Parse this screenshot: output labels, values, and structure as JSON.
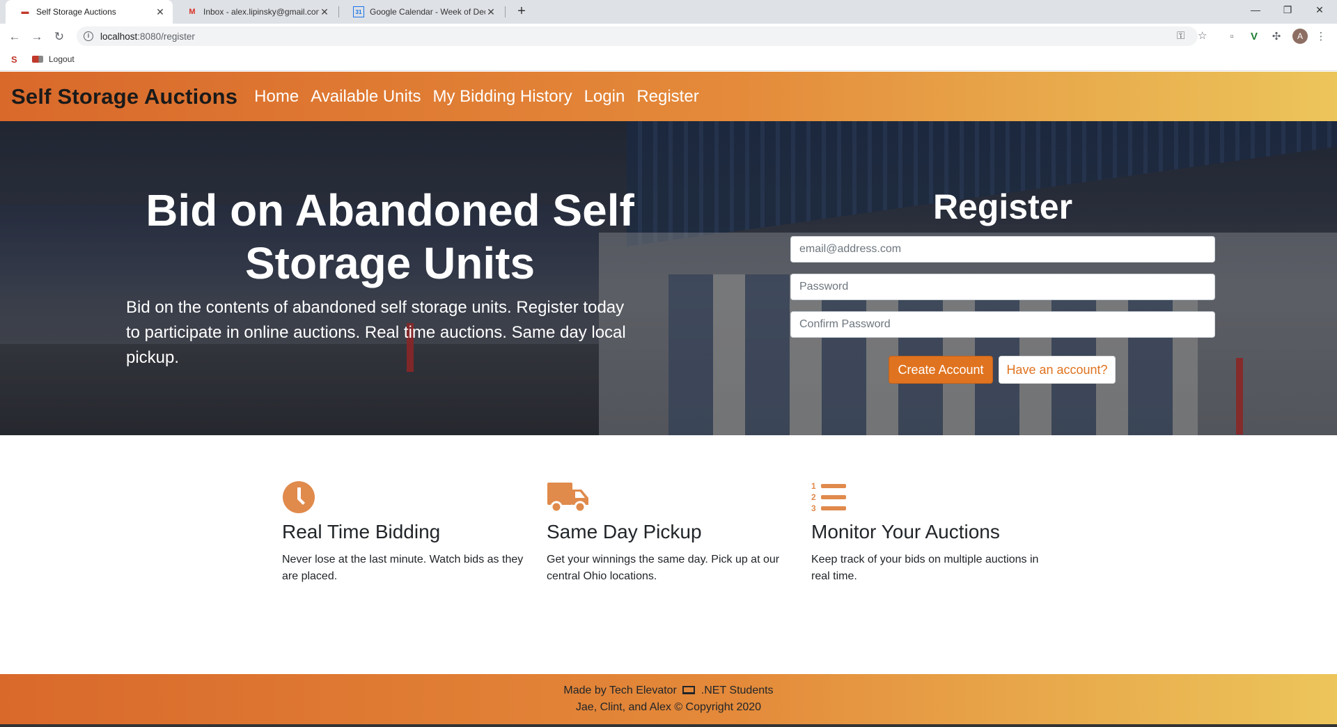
{
  "browser": {
    "tabs": [
      {
        "title": "Self Storage Auctions",
        "icon": "truck-favicon"
      },
      {
        "title": "Inbox - alex.lipinsky@gmail.com",
        "icon": "gmail-favicon"
      },
      {
        "title": "Google Calendar - Week of Dece",
        "icon": "calendar-favicon"
      }
    ],
    "url_host": "localhost",
    "url_rest": ":8080/register",
    "bookmarks": [
      {
        "label": "S"
      },
      {
        "label": "Logout"
      }
    ],
    "profile_initial": "A"
  },
  "site": {
    "brand": "Self Storage Auctions",
    "nav": [
      "Home",
      "Available Units",
      "My Bidding History",
      "Login",
      "Register"
    ]
  },
  "hero": {
    "title": "Bid on Abandoned Self Storage Units",
    "subtitle": "Bid on the contents of abandoned self storage units. Register today to participate in online auctions. Real time auctions. Same day local pickup."
  },
  "register": {
    "title": "Register",
    "email_placeholder": "email@address.com",
    "password_placeholder": "Password",
    "confirm_placeholder": "Confirm Password",
    "create_label": "Create Account",
    "have_account_label": "Have an account?"
  },
  "features": [
    {
      "icon": "clock-icon",
      "title": "Real Time Bidding",
      "text": "Never lose at the last minute. Watch bids as they are placed."
    },
    {
      "icon": "truck-icon",
      "title": "Same Day Pickup",
      "text": "Get your winnings the same day. Pick up at our central Ohio locations."
    },
    {
      "icon": "numbered-list-icon",
      "title": "Monitor Your Auctions",
      "text": "Keep track of your bids on multiple auctions in real time."
    }
  ],
  "footer": {
    "line1_a": "Made by Tech Elevator",
    "line1_b": ".NET Students",
    "line2": "Jae, Clint, and Alex © Copyright 2020"
  },
  "colors": {
    "accent": "#e0731f",
    "nav_gradient_start": "#d9692b",
    "nav_gradient_end": "#ecc55b"
  }
}
